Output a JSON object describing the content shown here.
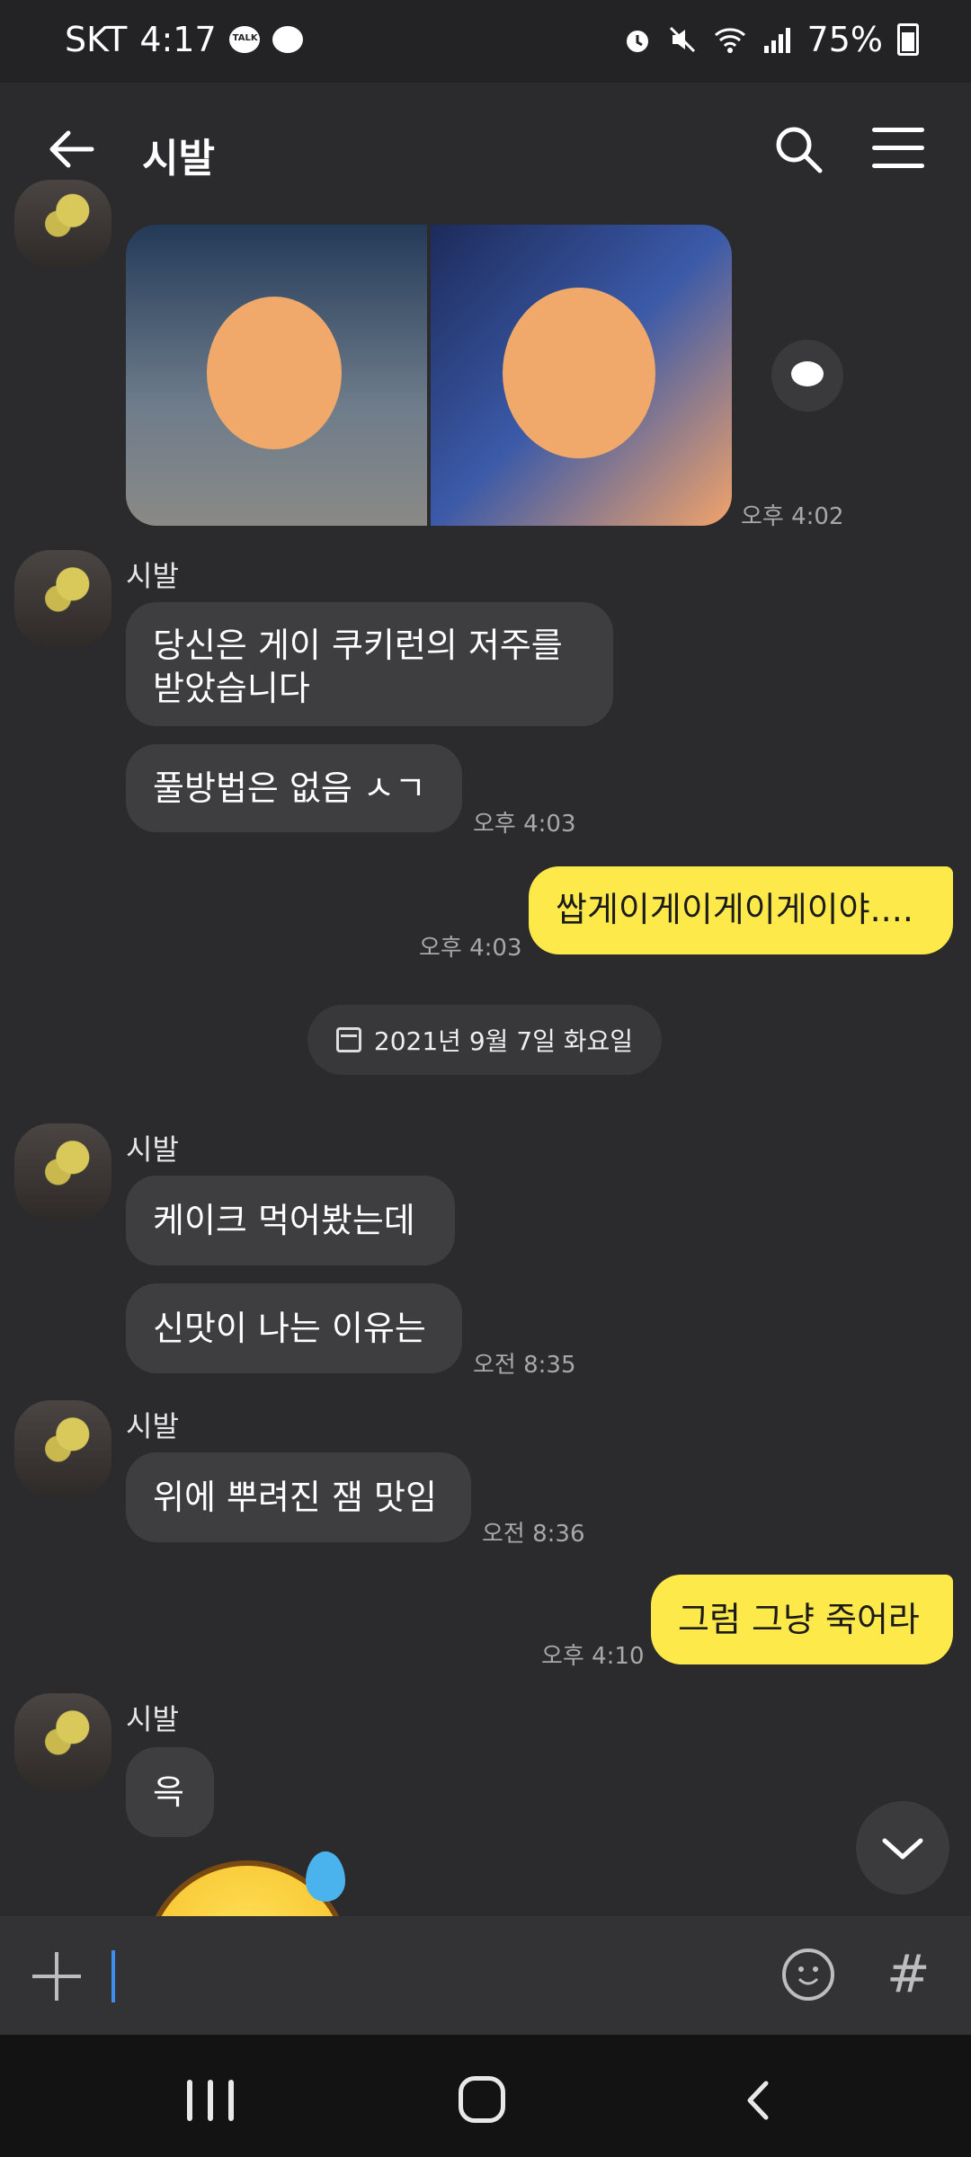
{
  "status_bar": {
    "carrier": "SKT",
    "time": "4:17",
    "battery": "75%",
    "icons": [
      "talk-icon",
      "chat-bubble-icon",
      "alarm-icon",
      "mute-icon",
      "wifi-icon",
      "signal-icon",
      "battery-icon"
    ]
  },
  "header": {
    "title": "시발",
    "icons": [
      "back-arrow-icon",
      "search-icon",
      "menu-icon"
    ]
  },
  "messages": {
    "photo_time": "오후 4:02",
    "m1": {
      "sender": "시발",
      "text1": "당신은 게이 쿠키런의 저주를",
      "text2": "받았습니다",
      "text3": "풀방법은 없음 ㅅㄱ",
      "time": "오후 4:03"
    },
    "r1": {
      "text": "쌉게이게이게이게이야....",
      "time": "오후 4:03"
    },
    "date": "2021년 9월 7일 화요일",
    "m2": {
      "sender": "시발",
      "text1": "케이크 먹어봤는데",
      "text2": "신맛이 나는 이유는",
      "time": "오전 8:35"
    },
    "m3": {
      "sender": "시발",
      "text1": "위에 뿌려진 잼 맛임",
      "time": "오전 8:36"
    },
    "r2": {
      "text": "그럼 그냥 죽어라",
      "time": "오후 4:10"
    },
    "m4": {
      "sender": "시발",
      "text1": "윽"
    }
  },
  "input": {
    "placeholder": ""
  },
  "colors": {
    "background": "#2b2b2d",
    "my_bubble": "#fde94a",
    "their_bubble": "#3e3e41",
    "accent_caret": "#3d8ef0"
  }
}
